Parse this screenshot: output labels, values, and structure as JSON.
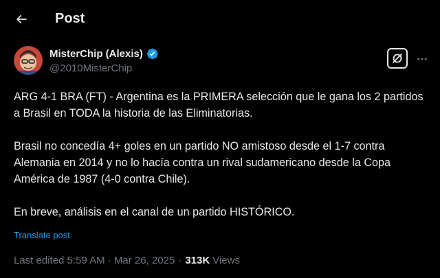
{
  "header": {
    "title": "Post",
    "back_icon": "arrow-left-icon"
  },
  "author": {
    "name": "MisterChip (Alexis)",
    "handle": "@2010MisterChip",
    "verified": true,
    "verified_color": "#1d9bf0"
  },
  "actions": {
    "grok_icon": "grok-icon",
    "more_icon": "more-horizontal-icon"
  },
  "post": {
    "paragraphs": [
      "ARG 4-1 BRA (FT) - Argentina es la PRIMERA selección que le gana los 2 partidos a Brasil en TODA la historia de las Eliminatorias.",
      "Brasil no concedía 4+ goles en un partido NO amistoso desde el 1-7 contra Alemania en 2014 y no lo hacía contra un rival sudamericano desde la Copa América de 1987 (4-0 contra Chile).",
      "En breve, análisis en el canal de un partido HISTÓRICO."
    ],
    "translate_label": "Translate post"
  },
  "meta": {
    "edited_label": "Last edited 5:59 AM · Mar 26, 2025",
    "separator": "·",
    "views_count": "313K",
    "views_label": "Views"
  },
  "colors": {
    "background": "#000000",
    "text": "#e7e9ea",
    "secondary": "#71767b",
    "link": "#1d9bf0"
  }
}
